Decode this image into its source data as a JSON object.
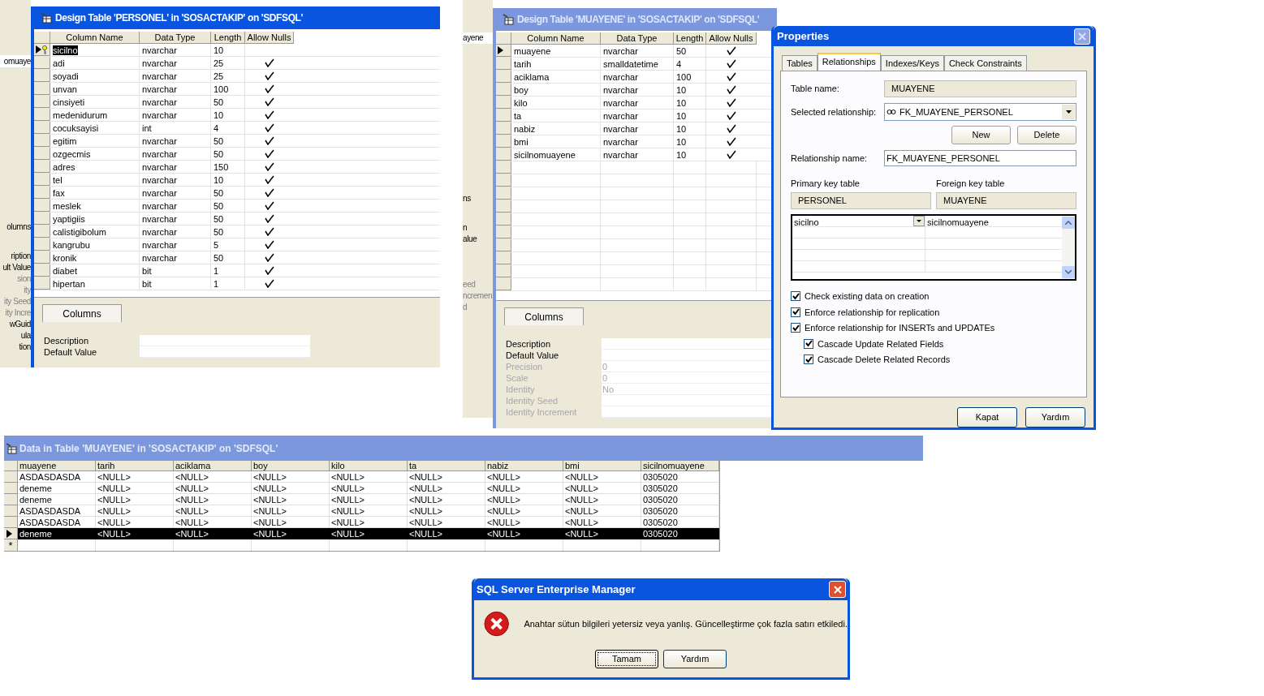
{
  "background_fragments": {
    "left": [
      "omuaye",
      "olumns",
      "ription",
      "ult Value",
      "sion",
      "ity",
      "ity Seed",
      "ity Incre",
      "wGuid",
      "ula",
      "tion"
    ],
    "middle": [
      "ayene",
      "ns",
      "n",
      "alue",
      "eed",
      "ncremen",
      "d"
    ]
  },
  "personel_window": {
    "title": "Design Table 'PERSONEL' in 'SOSACTAKIP' on 'SDFSQL'",
    "active": true,
    "columns": [
      "Column Name",
      "Data Type",
      "Length",
      "Allow Nulls"
    ],
    "rows": [
      {
        "name": "sicilno",
        "type": "nvarchar",
        "length": "10",
        "allow_nulls": false,
        "selected": true,
        "primary_key": true
      },
      {
        "name": "adi",
        "type": "nvarchar",
        "length": "25",
        "allow_nulls": true,
        "selected": false,
        "primary_key": false
      },
      {
        "name": "soyadi",
        "type": "nvarchar",
        "length": "25",
        "allow_nulls": true,
        "selected": false,
        "primary_key": false
      },
      {
        "name": "unvan",
        "type": "nvarchar",
        "length": "100",
        "allow_nulls": true,
        "selected": false,
        "primary_key": false
      },
      {
        "name": "cinsiyeti",
        "type": "nvarchar",
        "length": "50",
        "allow_nulls": true,
        "selected": false,
        "primary_key": false
      },
      {
        "name": "medenidurum",
        "type": "nvarchar",
        "length": "10",
        "allow_nulls": true,
        "selected": false,
        "primary_key": false
      },
      {
        "name": "cocuksayisi",
        "type": "int",
        "length": "4",
        "allow_nulls": true,
        "selected": false,
        "primary_key": false
      },
      {
        "name": "egitim",
        "type": "nvarchar",
        "length": "50",
        "allow_nulls": true,
        "selected": false,
        "primary_key": false
      },
      {
        "name": "ozgecmis",
        "type": "nvarchar",
        "length": "50",
        "allow_nulls": true,
        "selected": false,
        "primary_key": false
      },
      {
        "name": "adres",
        "type": "nvarchar",
        "length": "150",
        "allow_nulls": true,
        "selected": false,
        "primary_key": false
      },
      {
        "name": "tel",
        "type": "nvarchar",
        "length": "10",
        "allow_nulls": true,
        "selected": false,
        "primary_key": false
      },
      {
        "name": "fax",
        "type": "nvarchar",
        "length": "50",
        "allow_nulls": true,
        "selected": false,
        "primary_key": false
      },
      {
        "name": "meslek",
        "type": "nvarchar",
        "length": "50",
        "allow_nulls": true,
        "selected": false,
        "primary_key": false
      },
      {
        "name": "yaptigiis",
        "type": "nvarchar",
        "length": "50",
        "allow_nulls": true,
        "selected": false,
        "primary_key": false
      },
      {
        "name": "calistigibolum",
        "type": "nvarchar",
        "length": "50",
        "allow_nulls": true,
        "selected": false,
        "primary_key": false
      },
      {
        "name": "kangrubu",
        "type": "nvarchar",
        "length": "5",
        "allow_nulls": true,
        "selected": false,
        "primary_key": false
      },
      {
        "name": "kronik",
        "type": "nvarchar",
        "length": "50",
        "allow_nulls": true,
        "selected": false,
        "primary_key": false
      },
      {
        "name": "diabet",
        "type": "bit",
        "length": "1",
        "allow_nulls": true,
        "selected": false,
        "primary_key": false
      },
      {
        "name": "hipertan",
        "type": "bit",
        "length": "1",
        "allow_nulls": true,
        "selected": false,
        "primary_key": false
      }
    ],
    "tab": "Columns",
    "properties": [
      {
        "label": "Description",
        "disabled": false
      },
      {
        "label": "Default Value",
        "disabled": false
      }
    ]
  },
  "muayene_window": {
    "title": "Design Table 'MUAYENE' in 'SOSACTAKIP' on 'SDFSQL'",
    "active": false,
    "columns": [
      "Column Name",
      "Data Type",
      "Length",
      "Allow Nulls"
    ],
    "rows": [
      {
        "name": "muayene",
        "type": "nvarchar",
        "length": "50",
        "allow_nulls": true,
        "selected": false,
        "primary_key": false
      },
      {
        "name": "tarih",
        "type": "smalldatetime",
        "length": "4",
        "allow_nulls": true,
        "selected": false,
        "primary_key": false
      },
      {
        "name": "aciklama",
        "type": "nvarchar",
        "length": "100",
        "allow_nulls": true,
        "selected": false,
        "primary_key": false
      },
      {
        "name": "boy",
        "type": "nvarchar",
        "length": "10",
        "allow_nulls": true,
        "selected": false,
        "primary_key": false
      },
      {
        "name": "kilo",
        "type": "nvarchar",
        "length": "10",
        "allow_nulls": true,
        "selected": false,
        "primary_key": false
      },
      {
        "name": "ta",
        "type": "nvarchar",
        "length": "10",
        "allow_nulls": true,
        "selected": false,
        "primary_key": false
      },
      {
        "name": "nabiz",
        "type": "nvarchar",
        "length": "10",
        "allow_nulls": true,
        "selected": false,
        "primary_key": false
      },
      {
        "name": "bmi",
        "type": "nvarchar",
        "length": "10",
        "allow_nulls": true,
        "selected": false,
        "primary_key": false
      },
      {
        "name": "sicilnomuayene",
        "type": "nvarchar",
        "length": "10",
        "allow_nulls": true,
        "selected": false,
        "primary_key": false
      }
    ],
    "tab": "Columns",
    "properties": [
      {
        "label": "Description",
        "disabled": false
      },
      {
        "label": "Default Value",
        "disabled": false
      },
      {
        "label": "Precision",
        "disabled": true,
        "value": "0"
      },
      {
        "label": "Scale",
        "disabled": true,
        "value": "0"
      },
      {
        "label": "Identity",
        "disabled": true,
        "value": "No"
      },
      {
        "label": "Identity Seed",
        "disabled": true
      },
      {
        "label": "Identity Increment",
        "disabled": true
      }
    ]
  },
  "properties_dialog": {
    "title": "Properties",
    "tabs": [
      {
        "label": "Tables",
        "selected": false
      },
      {
        "label": "Relationships",
        "selected": true
      },
      {
        "label": "Indexes/Keys",
        "selected": false
      },
      {
        "label": "Check Constraints",
        "selected": false
      }
    ],
    "table_name_label": "Table name:",
    "table_name": "MUAYENE",
    "selected_relationship_label": "Selected relationship:",
    "selected_relationship": "FK_MUAYENE_PERSONEL",
    "buttons": [
      "New",
      "Delete"
    ],
    "relationship_name_label": "Relationship name:",
    "relationship_name": "FK_MUAYENE_PERSONEL",
    "primary_key_table_label": "Primary key table",
    "primary_key_table": "PERSONEL",
    "foreign_key_table_label": "Foreign key table",
    "foreign_key_table": "MUAYENE",
    "key_columns": [
      {
        "primary": "sicilno",
        "foreign": "sicilnomuayene"
      }
    ],
    "checkboxes": [
      {
        "label": "Check existing data on creation",
        "checked": true
      },
      {
        "label": "Enforce relationship for replication",
        "checked": true
      },
      {
        "label": "Enforce relationship for INSERTs and UPDATEs",
        "checked": true,
        "children": [
          {
            "label": "Cascade Update Related Fields",
            "checked": true
          },
          {
            "label": "Cascade Delete Related Records",
            "checked": true
          }
        ]
      }
    ],
    "footer_buttons": [
      "Kapat",
      "Yardım"
    ]
  },
  "data_window": {
    "title": "Data in Table 'MUAYENE' in 'SOSACTAKIP' on 'SDFSQL'",
    "columns": [
      "muayene",
      "tarih",
      "aciklama",
      "boy",
      "kilo",
      "ta",
      "nabiz",
      "bmi",
      "sicilnomuayene"
    ],
    "rows": [
      {
        "cells": [
          "ASDASDASDA",
          "<NULL>",
          "<NULL>",
          "<NULL>",
          "<NULL>",
          "<NULL>",
          "<NULL>",
          "<NULL>",
          "0305020"
        ],
        "selected": false
      },
      {
        "cells": [
          "deneme",
          "<NULL>",
          "<NULL>",
          "<NULL>",
          "<NULL>",
          "<NULL>",
          "<NULL>",
          "<NULL>",
          "0305020"
        ],
        "selected": false
      },
      {
        "cells": [
          "deneme",
          "<NULL>",
          "<NULL>",
          "<NULL>",
          "<NULL>",
          "<NULL>",
          "<NULL>",
          "<NULL>",
          "0305020"
        ],
        "selected": false
      },
      {
        "cells": [
          "ASDASDASDA",
          "<NULL>",
          "<NULL>",
          "<NULL>",
          "<NULL>",
          "<NULL>",
          "<NULL>",
          "<NULL>",
          "0305020"
        ],
        "selected": false
      },
      {
        "cells": [
          "ASDASDASDA",
          "<NULL>",
          "<NULL>",
          "<NULL>",
          "<NULL>",
          "<NULL>",
          "<NULL>",
          "<NULL>",
          "0305020"
        ],
        "selected": false
      },
      {
        "cells": [
          "deneme",
          "<NULL>",
          "<NULL>",
          "<NULL>",
          "<NULL>",
          "<NULL>",
          "<NULL>",
          "<NULL>",
          "0305020"
        ],
        "selected": true
      }
    ],
    "new_row_marker": "*"
  },
  "error_dialog": {
    "title": "SQL Server Enterprise Manager",
    "message": "Anahtar sütun bilgileri yetersiz veya yanlış. Güncelleştirme çok fazla satırı etkiledi.",
    "buttons": [
      {
        "label": "Tamam",
        "focused": true
      },
      {
        "label": "Yardım",
        "focused": false
      }
    ]
  }
}
